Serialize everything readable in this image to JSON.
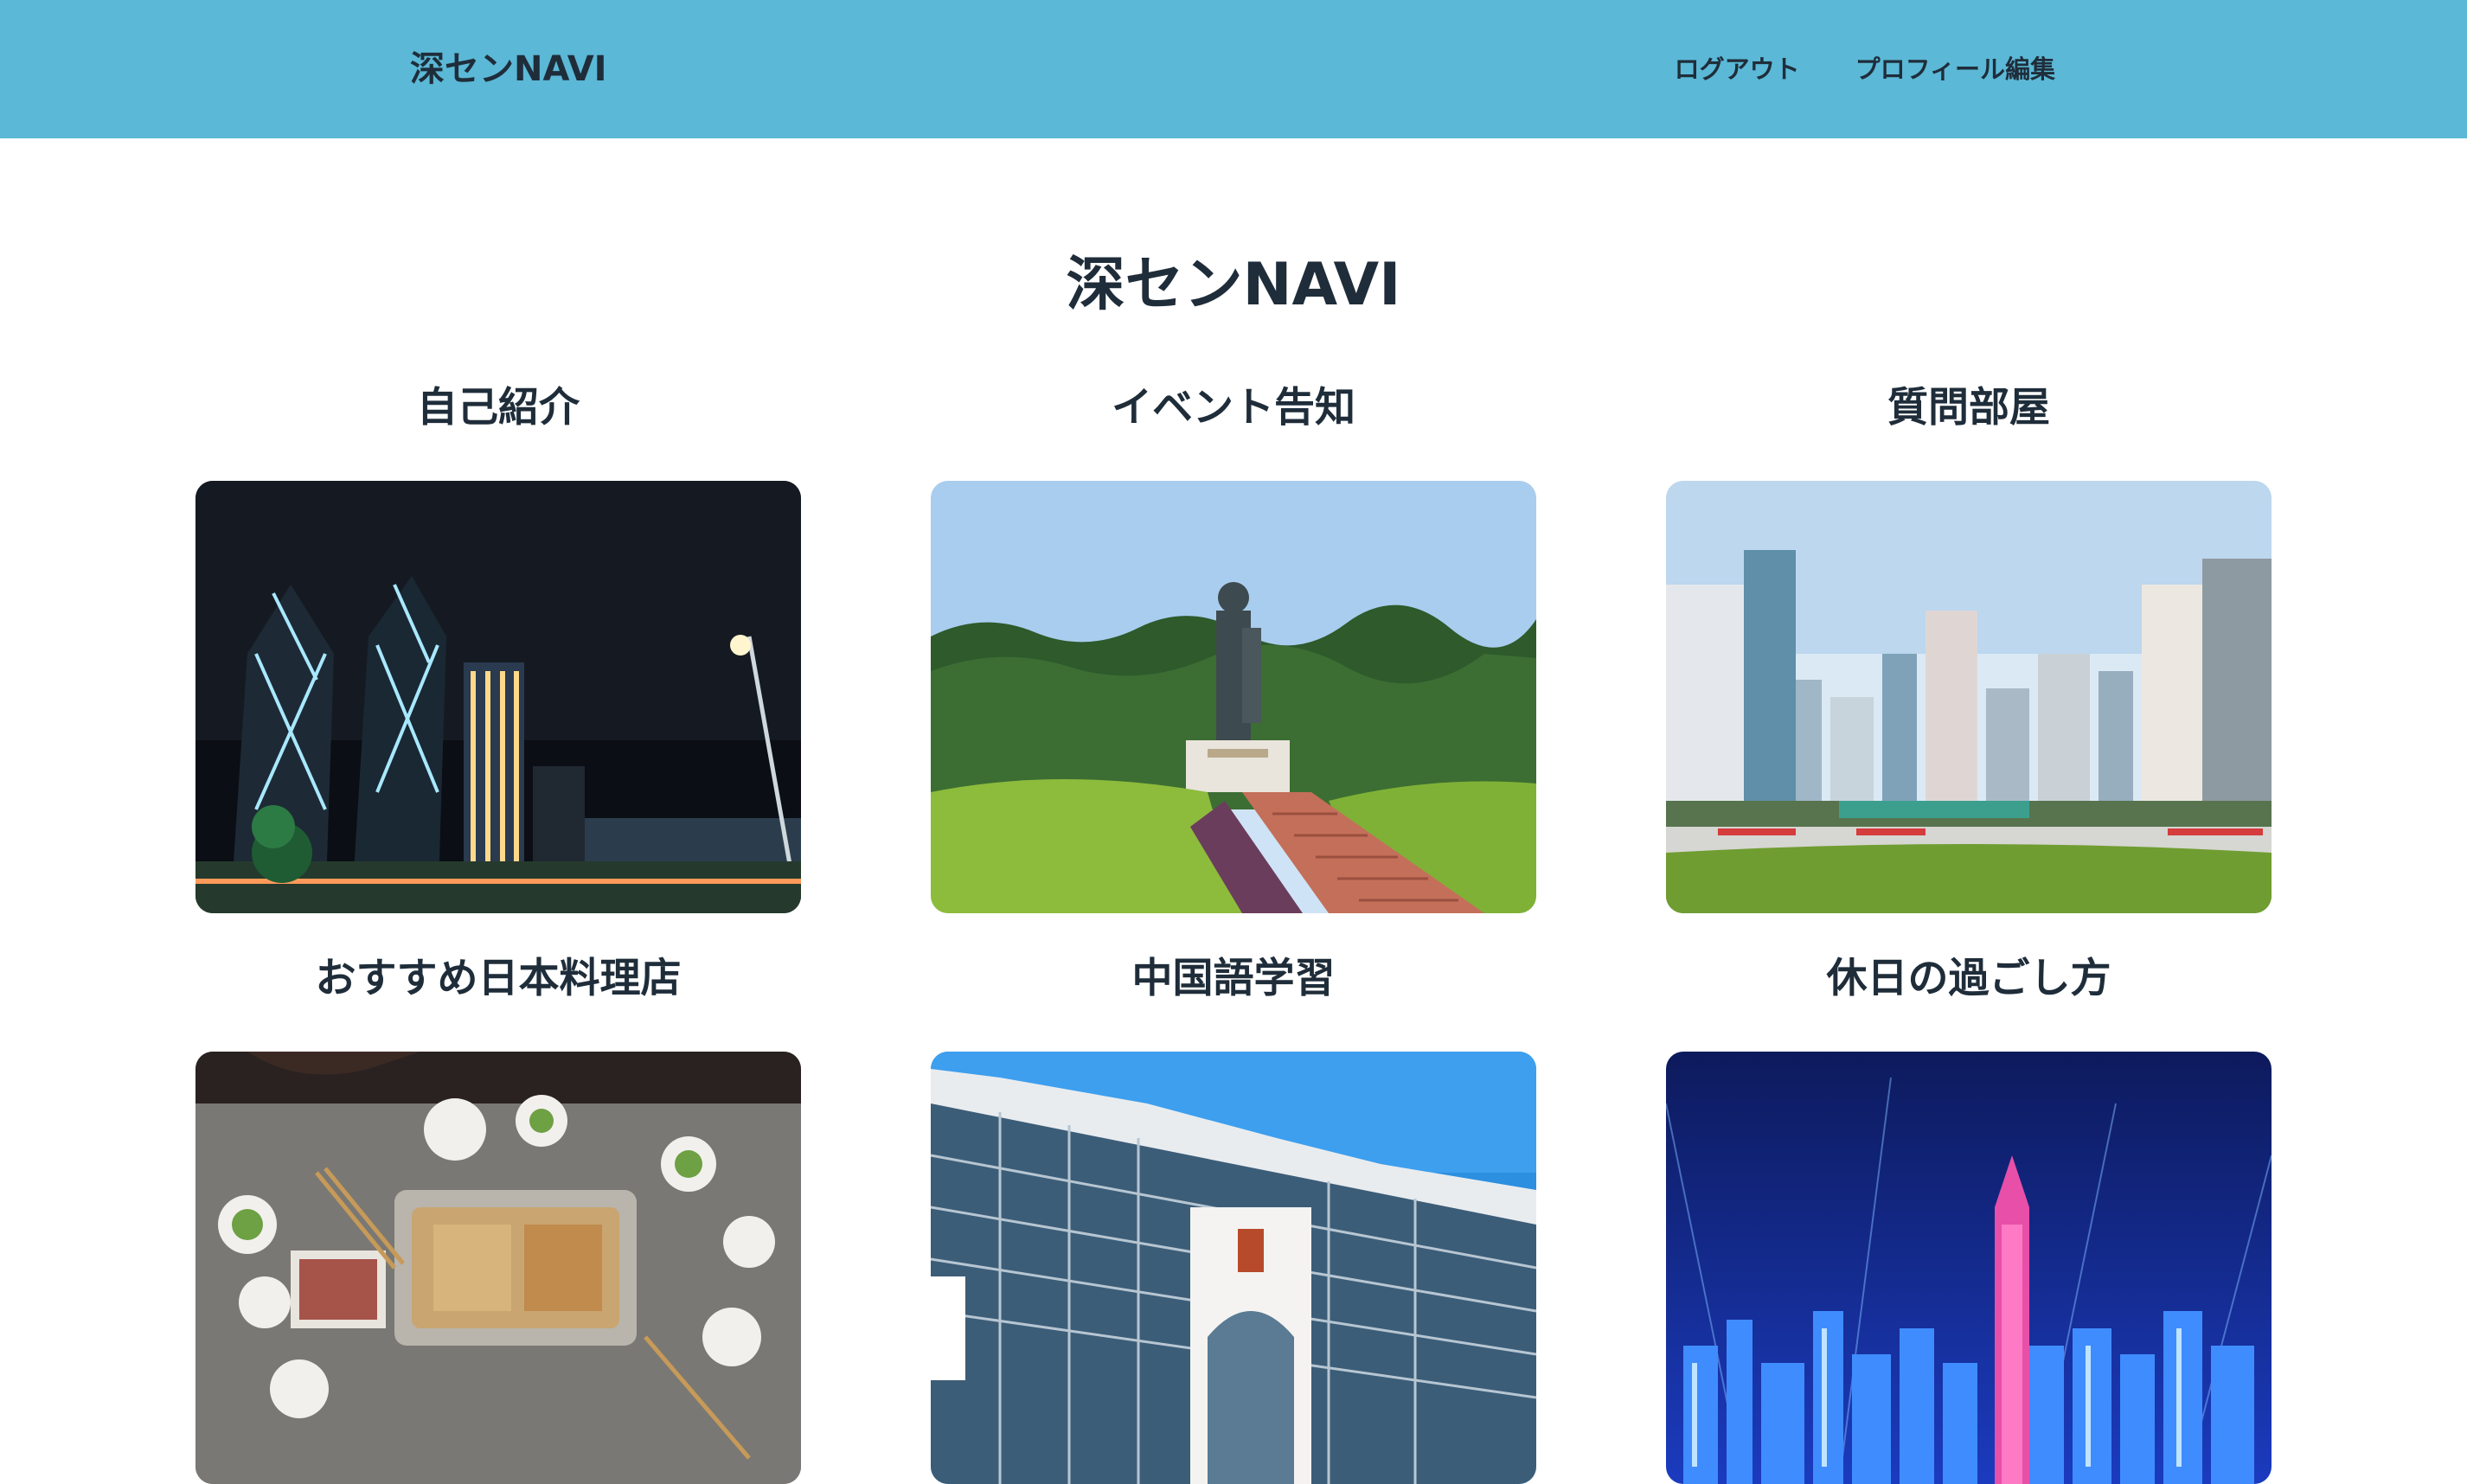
{
  "header": {
    "brand": "深センNAVI",
    "nav": {
      "logout": "ログアウト",
      "edit_profile": "プロフィール編集"
    },
    "background_color": "#5bb8d6"
  },
  "main": {
    "title": "深センNAVI",
    "cards": [
      {
        "title": "自己紹介",
        "image": "night-skyline-photo"
      },
      {
        "title": "イベント告知",
        "image": "statue-park-photo"
      },
      {
        "title": "質問部屋",
        "image": "city-plaza-photo"
      },
      {
        "title": "おすすめ日本料理店",
        "image": "hotpot-table-photo"
      },
      {
        "title": "中国語学習",
        "image": "station-building-photo"
      },
      {
        "title": "休日の過ごし方",
        "image": "night-city-lights-photo"
      }
    ]
  }
}
